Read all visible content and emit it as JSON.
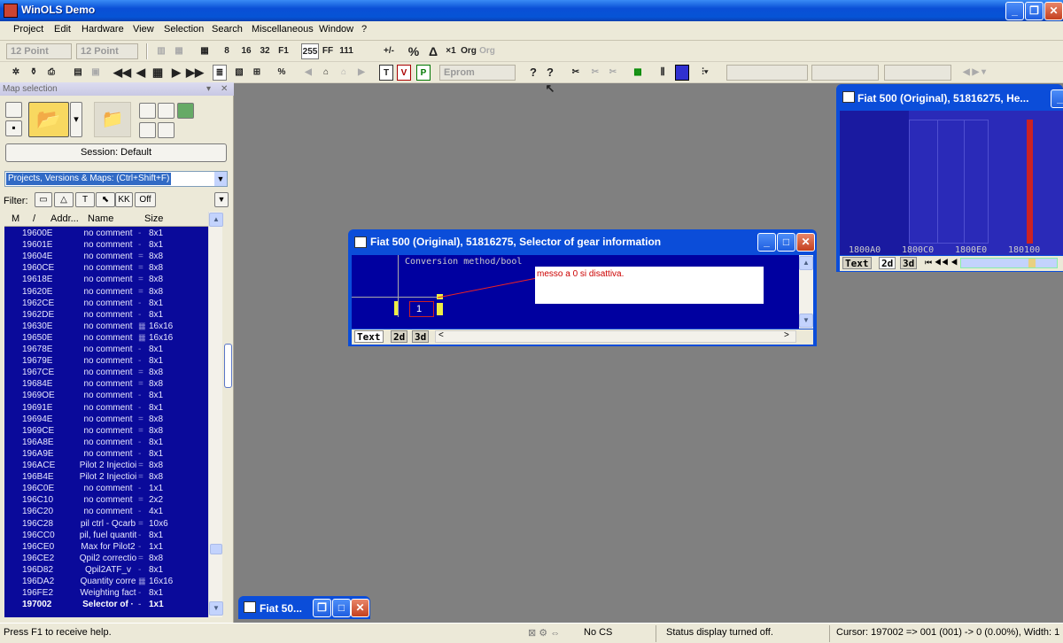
{
  "app": {
    "title": "WinOLS Demo"
  },
  "menu": [
    "Project",
    "Edit",
    "Hardware",
    "View",
    "Selection",
    "Search",
    "Miscellaneous",
    "Window",
    "?"
  ],
  "toolbar1": {
    "font_a": "12 Point",
    "font_b": "12 Point",
    "labels": [
      "8",
      "16",
      "32",
      "F1",
      "255",
      "FF",
      "111",
      "+/-",
      "%",
      "×1",
      "Org"
    ]
  },
  "toolbar2": {
    "eprom": "Eprom"
  },
  "map_selection": {
    "panel_title": "Map selection",
    "session_button": "Session: Default",
    "project_selector": "Projects, Versions & Maps:  (Ctrl+Shift+F)",
    "filter_label": "Filter:",
    "filter_off": "Off",
    "columns": [
      "M",
      "/",
      "Addr...",
      "Name",
      "Size"
    ],
    "rows": [
      {
        "addr": "19600E",
        "name": "no comment",
        "size": "8x1"
      },
      {
        "addr": "19601E",
        "name": "no comment",
        "size": "8x1"
      },
      {
        "addr": "19604E",
        "name": "no comment",
        "size": "8x8"
      },
      {
        "addr": "1960CE",
        "name": "no comment",
        "size": "8x8"
      },
      {
        "addr": "19618E",
        "name": "no comment",
        "size": "8x8"
      },
      {
        "addr": "19620E",
        "name": "no comment",
        "size": "8x8"
      },
      {
        "addr": "1962CE",
        "name": "no comment",
        "size": "8x1"
      },
      {
        "addr": "1962DE",
        "name": "no comment",
        "size": "8x1"
      },
      {
        "addr": "19630E",
        "name": "no comment",
        "size": "16x16"
      },
      {
        "addr": "19650E",
        "name": "no comment",
        "size": "16x16"
      },
      {
        "addr": "19678E",
        "name": "no comment",
        "size": "8x1"
      },
      {
        "addr": "19679E",
        "name": "no comment",
        "size": "8x1"
      },
      {
        "addr": "1967CE",
        "name": "no comment",
        "size": "8x8"
      },
      {
        "addr": "19684E",
        "name": "no comment",
        "size": "8x8"
      },
      {
        "addr": "1969OE",
        "name": "no comment",
        "size": "8x1"
      },
      {
        "addr": "19691E",
        "name": "no comment",
        "size": "8x1"
      },
      {
        "addr": "19694E",
        "name": "no comment",
        "size": "8x8"
      },
      {
        "addr": "1969CE",
        "name": "no comment",
        "size": "8x8"
      },
      {
        "addr": "196A8E",
        "name": "no comment",
        "size": "8x1"
      },
      {
        "addr": "196A9E",
        "name": "no comment",
        "size": "8x1"
      },
      {
        "addr": "196ACE",
        "name": "Pilot 2 Injectioi",
        "size": "8x8"
      },
      {
        "addr": "196B4E",
        "name": "Pilot 2 Injectioi",
        "size": "8x8"
      },
      {
        "addr": "196C0E",
        "name": "no comment",
        "size": "1x1"
      },
      {
        "addr": "196C10",
        "name": "no comment",
        "size": "2x2"
      },
      {
        "addr": "196C20",
        "name": "no comment",
        "size": "4x1"
      },
      {
        "addr": "196C28",
        "name": "pil ctrl - Qcarb",
        "size": "10x6"
      },
      {
        "addr": "196CC0",
        "name": "pil, fuel quantit",
        "size": "8x1"
      },
      {
        "addr": "196CE0",
        "name": "Max for Pilot2",
        "size": "1x1"
      },
      {
        "addr": "196CE2",
        "name": "Qpil2 correctio",
        "size": "8x8"
      },
      {
        "addr": "196D82",
        "name": "Qpil2ATF_v",
        "size": "8x1"
      },
      {
        "addr": "196DA2",
        "name": "Quantity corre",
        "size": "16x16"
      },
      {
        "addr": "196FE2",
        "name": "Weighting fact",
        "size": "8x1"
      },
      {
        "addr": "197002",
        "name": "Selector of ·",
        "size": "1x1"
      }
    ]
  },
  "map_window": {
    "title": "Fiat 500 (Original), 51816275, Selector of gear information",
    "conversion": "Conversion method/bool",
    "cell_value": "1",
    "annotation": "messo a 0 si disattiva.",
    "tabs": [
      "Text",
      "2d",
      "3d"
    ]
  },
  "hex_window": {
    "title": "Fiat 500 (Original), 51816275, He...",
    "axis_labels": [
      "1800A0",
      "1800C0",
      "1800E0",
      "180100"
    ],
    "tabs": [
      "Text",
      "2d",
      "3d"
    ],
    "colors": {
      "highlight": "#cc2222",
      "area": "#2020c0"
    }
  },
  "minimized_window": {
    "title": "Fiat 50..."
  },
  "status": {
    "help": "Press F1 to receive help.",
    "checksum": "No CS",
    "message": "Status display turned off.",
    "cursor": "Cursor: 197002 => 001 (001) -> 0 (0.00%), Width: 1"
  }
}
